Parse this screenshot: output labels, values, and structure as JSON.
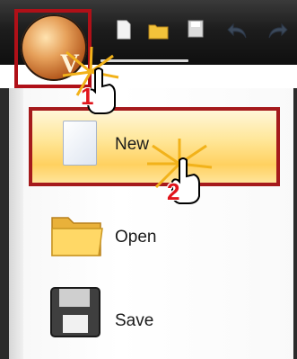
{
  "toolbar": {
    "icons": [
      "app-orb-icon",
      "new-doc-icon",
      "open-folder-icon",
      "save-icon",
      "undo-icon",
      "redo-icon"
    ]
  },
  "menu": {
    "items": [
      {
        "label": "New",
        "icon": "new-document-icon"
      },
      {
        "label": "Open",
        "icon": "folder-icon"
      },
      {
        "label": "Save",
        "icon": "save-disk-icon"
      }
    ]
  },
  "annotations": {
    "step1": "1",
    "step2": "2"
  },
  "colors": {
    "highlight_border": "#a51a1c",
    "step_number": "#e0141b",
    "toolbar_bg": "#1d1d1d"
  }
}
